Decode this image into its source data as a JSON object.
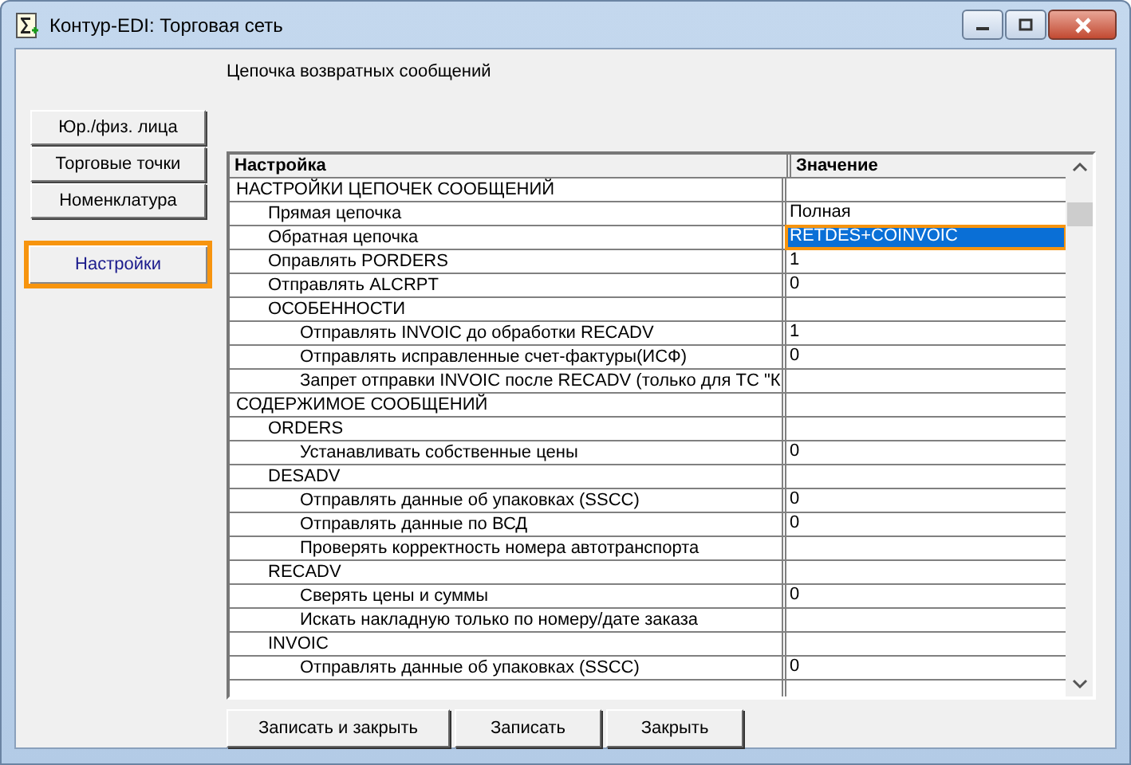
{
  "window": {
    "title": "Контур-EDI: Торговая сеть"
  },
  "heading": "Цепочка возвратных сообщений",
  "sidebar": {
    "items": [
      {
        "label": "Юр./физ. лица",
        "selected": false
      },
      {
        "label": "Торговые точки",
        "selected": false
      },
      {
        "label": "Номенклатура",
        "selected": false
      }
    ],
    "settings_button": {
      "label": "Настройки",
      "selected": true
    }
  },
  "table": {
    "columns": [
      "Настройка",
      "Значение"
    ],
    "rows": [
      {
        "setting": "НАСТРОЙКИ ЦЕПОЧЕК СООБЩЕНИЙ",
        "selected": false,
        "children": [
          {
            "setting": "Прямая цепочка",
            "value": "Полная",
            "selected": false
          },
          {
            "setting": "Обратная цепочка",
            "value": "RETDES+COINVOIC",
            "selected": true
          },
          {
            "setting": "Оправлять PORDERS",
            "value": "1",
            "selected": false
          },
          {
            "setting": "Отправлять ALCRPT",
            "value": "0",
            "selected": false
          },
          {
            "setting": "ОСОБЕННОСТИ",
            "selected": false,
            "children": [
              {
                "setting": "Отправлять INVOIC до обработки RECADV",
                "value": "1",
                "selected": false
              },
              {
                "setting": "Отправлять исправленные счет-фактуры(ИСФ)",
                "value": "0",
                "selected": false
              },
              {
                "setting": "Запрет отправки INVOIC после RECADV (только для ТС \"К",
                "selected": false
              }
            ]
          }
        ]
      },
      {
        "setting": "СОДЕРЖИМОЕ СООБЩЕНИЙ",
        "selected": false,
        "children": [
          {
            "setting": "ORDERS",
            "selected": false,
            "children": [
              {
                "setting": "Устанавливать собственные цены",
                "value": "0",
                "selected": false
              }
            ]
          },
          {
            "setting": "DESADV",
            "selected": false,
            "children": [
              {
                "setting": "Отправлять данные об упаковках (SSCC)",
                "value": "0",
                "selected": false
              },
              {
                "setting": "Отправлять данные по ВСД",
                "value": "0",
                "selected": false
              },
              {
                "setting": "Проверять корректность номера автотранспорта",
                "selected": false
              }
            ]
          },
          {
            "setting": "RECADV",
            "selected": false,
            "children": [
              {
                "setting": "Сверять цены и суммы",
                "value": "0",
                "selected": false
              },
              {
                "setting": "Искать накладную только по номеру/дате заказа",
                "selected": false
              }
            ]
          },
          {
            "setting": "INVOIC",
            "selected": false,
            "children": [
              {
                "setting": "Отправлять данные об упаковках (SSCC)",
                "value": "0",
                "selected": false
              }
            ]
          }
        ]
      }
    ]
  },
  "buttons": [
    "Записать и закрыть",
    "Записать",
    "Закрыть"
  ]
}
